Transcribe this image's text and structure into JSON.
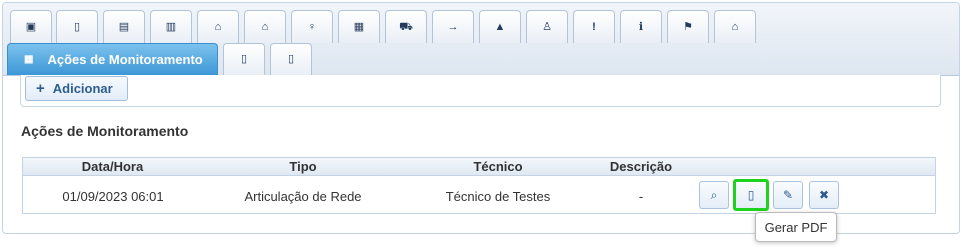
{
  "tabs_top": [
    {
      "icon": "id-card-icon",
      "glyph": "▣"
    },
    {
      "icon": "clipboard-icon",
      "glyph": "▯"
    },
    {
      "icon": "document-list-icon",
      "glyph": "▤"
    },
    {
      "icon": "books-icon",
      "glyph": "▥"
    },
    {
      "icon": "home-icon",
      "glyph": "⌂"
    },
    {
      "icon": "building-icon",
      "glyph": "⌂"
    },
    {
      "icon": "lightbulb-icon",
      "glyph": "♀"
    },
    {
      "icon": "table-icon",
      "glyph": "▦"
    },
    {
      "icon": "cart-icon",
      "glyph": "⛟"
    },
    {
      "icon": "arrow-right-icon",
      "glyph": "→"
    },
    {
      "icon": "warning-icon",
      "glyph": "▲"
    },
    {
      "icon": "user-stamp-icon",
      "glyph": "♙"
    },
    {
      "icon": "exclamation-icon",
      "glyph": "!"
    },
    {
      "icon": "info-icon",
      "glyph": "ℹ"
    },
    {
      "icon": "flag-icon",
      "glyph": "⚑"
    },
    {
      "icon": "home-alt-icon",
      "glyph": "⌂"
    }
  ],
  "tabs_second": {
    "active": {
      "icon": "table-icon",
      "glyph": "▦",
      "label": "Ações de Monitoramento"
    },
    "others": [
      {
        "icon": "file-icon",
        "glyph": "▯"
      },
      {
        "icon": "clipboard-icon",
        "glyph": "▯"
      }
    ]
  },
  "toolbar": {
    "add_label": "Adicionar",
    "add_icon": "plus-icon",
    "add_glyph": "+"
  },
  "section": {
    "title": "Ações de Monitoramento"
  },
  "table": {
    "headers": [
      "Data/Hora",
      "Tipo",
      "Técnico",
      "Descrição"
    ],
    "rows": [
      {
        "data_hora": "01/09/2023 06:01",
        "tipo": "Articulação de Rede",
        "tecnico": "Técnico de Testes",
        "descricao": "-"
      }
    ],
    "actions": [
      {
        "name": "search-icon",
        "glyph": "⌕"
      },
      {
        "name": "file-pdf-icon",
        "glyph": "▯"
      },
      {
        "name": "edit-icon",
        "glyph": "✎"
      },
      {
        "name": "close-icon",
        "glyph": "✖"
      }
    ]
  },
  "tooltip": {
    "text": "Gerar PDF"
  },
  "colors": {
    "active_tab": "#3d97d6",
    "focus_outline": "#1ed31e",
    "border": "#c5d4e4"
  }
}
